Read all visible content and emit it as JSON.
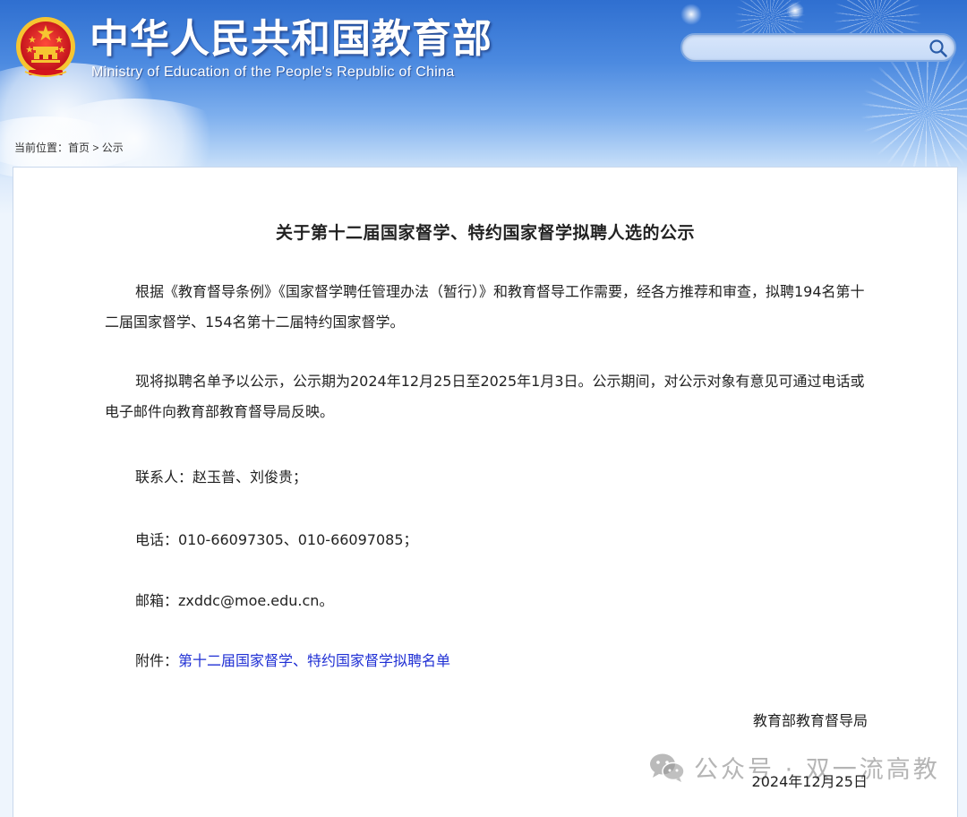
{
  "header": {
    "title": "中华人民共和国教育部",
    "subtitle": "Ministry of Education of the People's Republic of China",
    "search_placeholder": "",
    "emblem_icon": "national-emblem-icon",
    "search_icon": "search-icon"
  },
  "breadcrumb": {
    "prefix": "当前位置：",
    "home": "首页",
    "separator": " > ",
    "current": "公示"
  },
  "article": {
    "title": "关于第十二届国家督学、特约国家督学拟聘人选的公示",
    "paragraph1": "根据《教育督导条例》《国家督学聘任管理办法（暂行）》和教育督导工作需要，经各方推荐和审查，拟聘194名第十二届国家督学、154名第十二届特约国家督学。",
    "paragraph2": "现将拟聘名单予以公示，公示期为2024年12月25日至2025年1月3日。公示期间，对公示对象有意见可通过电话或电子邮件向教育部教育督导局反映。",
    "contact": "联系人：赵玉普、刘俊贵；",
    "phone": "电话：010-66097305、010-66097085；",
    "email": "邮箱：zxddc@moe.edu.cn。",
    "attachment_label": "附件：",
    "attachment_link": "第十二届国家督学、特约国家督学拟聘名单",
    "signature": "教育部教育督导局",
    "date": "2024年12月25日"
  },
  "watermark": {
    "text": "公众号 · 双一流高教",
    "icon": "wechat-icon"
  },
  "colors": {
    "header_blue": "#2f6fd0",
    "link": "#1f2fd4",
    "text": "#222222",
    "emblem_red": "#d4141c",
    "emblem_gold": "#f6c531"
  }
}
